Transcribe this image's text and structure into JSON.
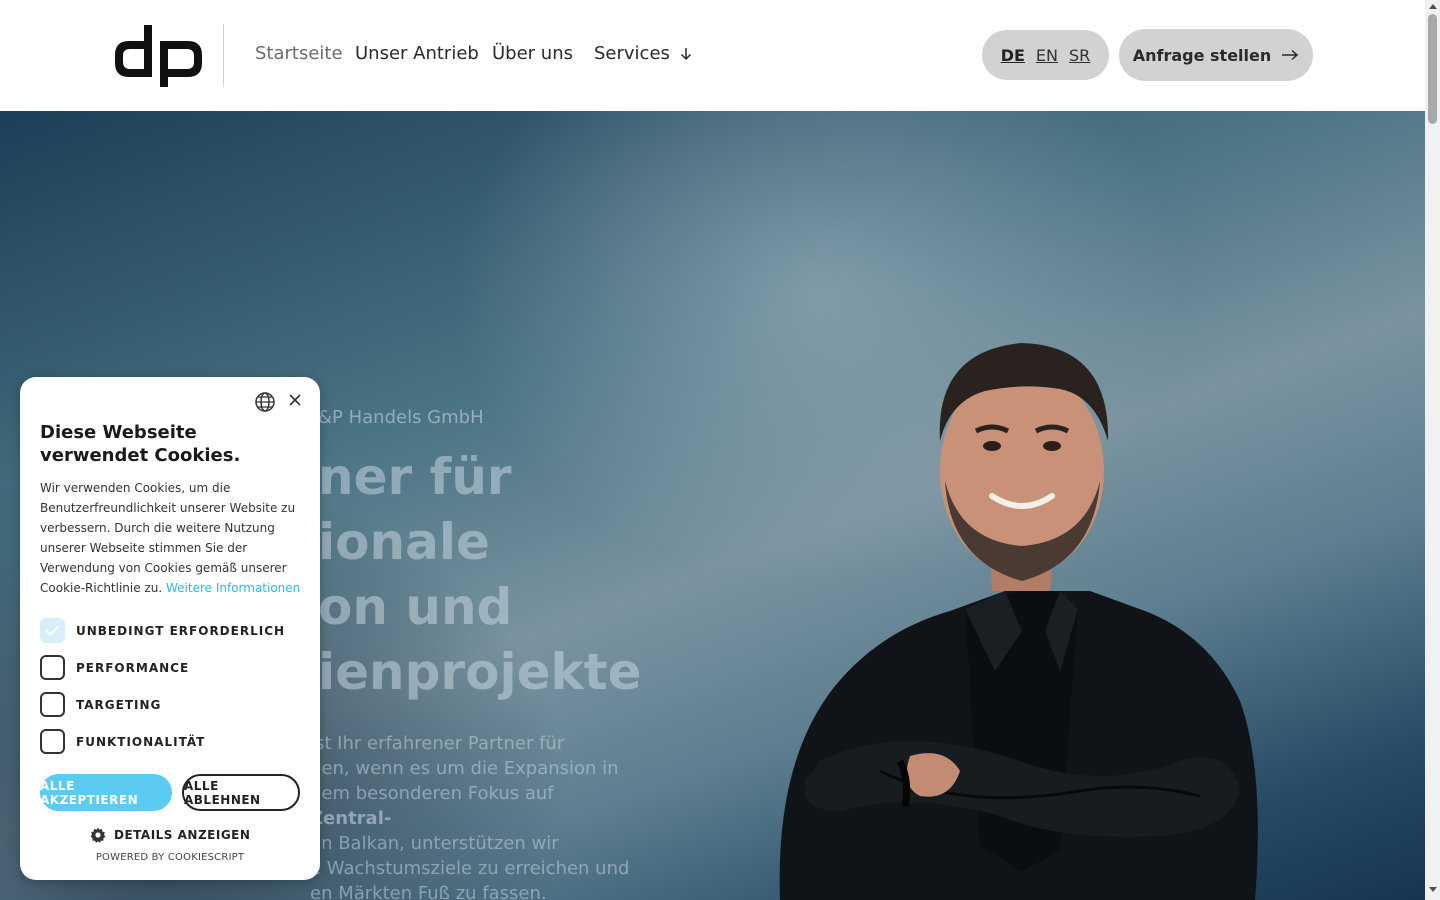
{
  "header": {
    "nav": [
      {
        "label": "Startseite",
        "active": true
      },
      {
        "label": "Unser Antrieb",
        "active": false
      },
      {
        "label": "Über uns",
        "active": false
      },
      {
        "label": "Services",
        "active": false,
        "has_dropdown": true
      }
    ],
    "languages": [
      {
        "code": "DE",
        "current": true
      },
      {
        "code": "EN",
        "current": false
      },
      {
        "code": "SR",
        "current": false
      }
    ],
    "cta_label": "Anfrage stellen"
  },
  "hero": {
    "kicker": "&P Handels GmbH",
    "headline_lines": [
      "ner für",
      "ionale",
      "on und",
      "ienprojekte"
    ],
    "paragraph_lines": [
      "ist Ihr erfahrener Partner für",
      "gen, wenn es um die Expansion in",
      "nem besonderen Fokus auf ",
      "en Balkan, unterstützen wir",
      "e Wachstumsziele zu erreichen und",
      "en Märkten Fuß zu fassen."
    ],
    "paragraph_bold": "Zentral-"
  },
  "cookie_banner": {
    "title": "Diese Webseite verwendet Cookies.",
    "body": "Wir verwenden Cookies, um die Benutzerfreundlichkeit unserer Website zu verbessern. Durch die weitere Nutzung unserer Webseite stimmen Sie der Verwendung von Cookies gemäß unserer Cookie-Richtlinie zu. ",
    "more_info_link": "Weitere Informationen",
    "options": [
      {
        "label": "UNBEDINGT ERFORDERLICH",
        "checked": true
      },
      {
        "label": "PERFORMANCE",
        "checked": false
      },
      {
        "label": "TARGETING",
        "checked": false
      },
      {
        "label": "FUNKTIONALITÄT",
        "checked": false
      }
    ],
    "accept_label": "ALLE AKZEPTIEREN",
    "reject_label": "ALLE ABLEHNEN",
    "details_label": "DETAILS ANZEIGEN",
    "powered_by": "POWERED BY COOKIESCRIPT",
    "accent_color": "#5ccbf1"
  }
}
